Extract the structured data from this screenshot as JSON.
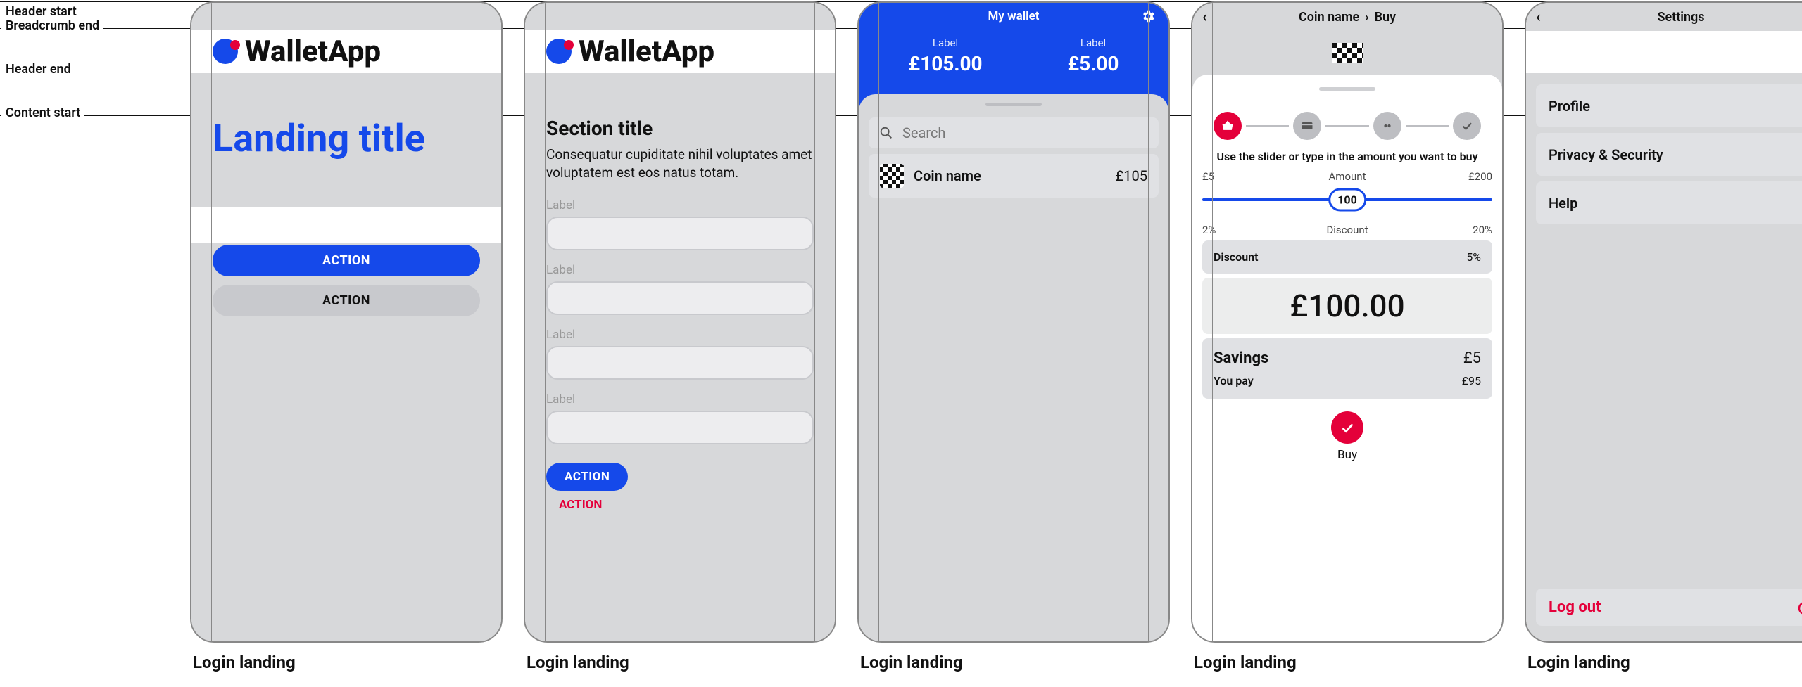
{
  "guides": {
    "header_start": "Header start",
    "breadcrumb_end": "Breadcrumb end",
    "header_end": "Header end",
    "content_start": "Content start"
  },
  "captions": [
    "Login landing",
    "Login landing",
    "Login landing",
    "Login landing",
    "Login landing"
  ],
  "screen1": {
    "brand": "WalletApp",
    "title": "Landing title",
    "primary_action": "ACTION",
    "secondary_action": "ACTION"
  },
  "screen2": {
    "brand": "WalletApp",
    "section_title": "Section title",
    "section_body": "Consequatur cupiditate nihil voluptates amet voluptatem est eos natus totam.",
    "fields": [
      "Label",
      "Label",
      "Label",
      "Label"
    ],
    "primary_action": "ACTION",
    "link_action": "ACTION"
  },
  "screen3": {
    "title": "My wallet",
    "gear_icon": "gear",
    "balances": [
      {
        "label": "Label",
        "value": "£105.00"
      },
      {
        "label": "Label",
        "value": "£5.00"
      }
    ],
    "search_placeholder": "Search",
    "coin": {
      "name": "Coin name",
      "value": "£105"
    }
  },
  "screen4": {
    "breadcrumb_parent": "Coin name",
    "breadcrumb_current": "Buy",
    "instruction": "Use the slider or type in the amount you want to buy",
    "amount_min": "£5",
    "amount_label": "Amount",
    "amount_max": "£200",
    "slider_value": "100",
    "discount_min": "2%",
    "discount_label": "Discount",
    "discount_max": "20%",
    "discount_row_label": "Discount",
    "discount_row_value": "5%",
    "amount_display": "£100.00",
    "savings_title": "Savings",
    "savings_value": "£5",
    "youpay_label": "You pay",
    "youpay_value": "£95",
    "buy_label": "Buy"
  },
  "screen5": {
    "title": "Settings",
    "items": [
      "Profile",
      "Privacy & Security",
      "Help"
    ],
    "logout": "Log out"
  }
}
